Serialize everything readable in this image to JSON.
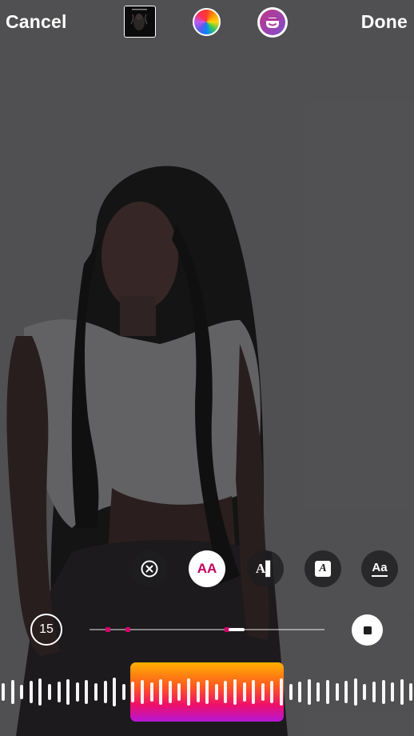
{
  "topbar": {
    "cancel_label": "Cancel",
    "done_label": "Done",
    "album_art_icon": "album-art-thumbnail",
    "color_icon": "color-wheel-icon",
    "filter_icon": "face-filter-icon"
  },
  "style_buttons": [
    {
      "name": "clear",
      "icon": "close-circle-icon",
      "label": ""
    },
    {
      "name": "text-style-aa",
      "icon": "text-style-icon",
      "label": "AA"
    },
    {
      "name": "text-style-karaoke",
      "icon": "text-cursor-icon",
      "label": "A▌"
    },
    {
      "name": "text-style-boxed",
      "icon": "text-box-icon",
      "label": "A"
    },
    {
      "name": "text-style-underline",
      "icon": "text-underline-icon",
      "label": "Aa"
    }
  ],
  "timeline": {
    "duration_label": "15",
    "stop_icon": "stop-icon"
  },
  "colors": {
    "accent": "#d6006b",
    "selection_top": "#ffb000",
    "selection_bottom": "#b516d8"
  }
}
